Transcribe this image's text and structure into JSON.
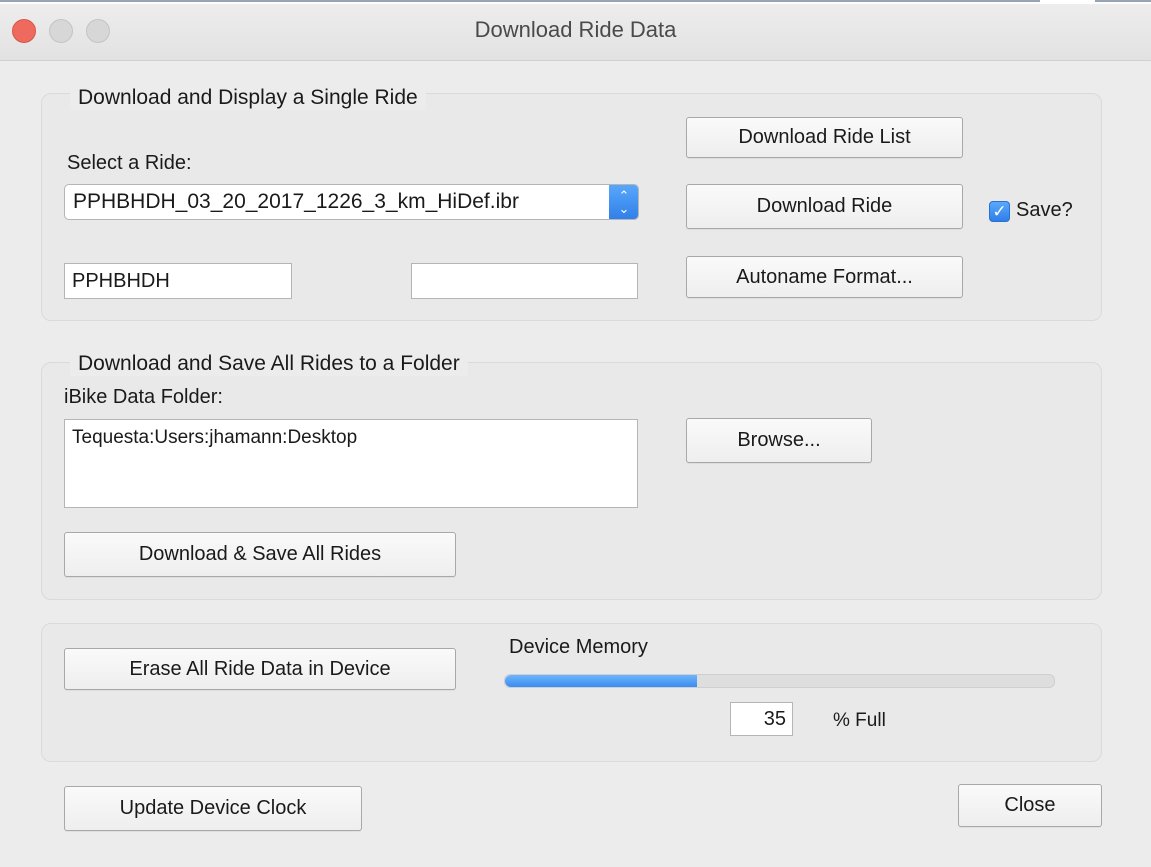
{
  "window": {
    "title": "Download Ride Data"
  },
  "single_ride": {
    "group_title": "Download and Display a Single Ride",
    "select_label": "Select a Ride:",
    "selected_ride": "PPHBHDH_03_20_2017_1226_3_km_HiDef.ibr",
    "download_list_label": "Download Ride List",
    "download_ride_label": "Download Ride",
    "save_checkbox_label": "Save?",
    "save_checked": true,
    "name_field_value": "PPHBHDH",
    "second_field_value": "",
    "autoname_label": "Autoname Format..."
  },
  "all_rides": {
    "group_title": "Download and Save All Rides to a Folder",
    "folder_label": "iBike Data Folder:",
    "folder_path": "Tequesta:Users:jhamann:Desktop",
    "browse_label": "Browse...",
    "download_all_label": "Download & Save All Rides"
  },
  "memory": {
    "erase_label": "Erase All Ride Data in Device",
    "memory_label": "Device Memory",
    "percent_value": "35",
    "percent_fraction": 0.35,
    "percent_suffix": "% Full"
  },
  "footer": {
    "update_clock_label": "Update Device Clock",
    "close_label": "Close"
  },
  "colors": {
    "accent": "#3a8cf0",
    "close_light": "#ef6a5e",
    "window_bg": "#ececec"
  }
}
